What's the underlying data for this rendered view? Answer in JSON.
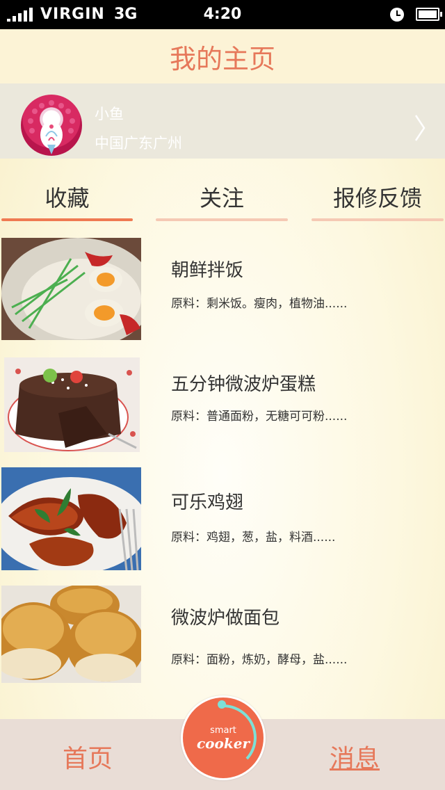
{
  "status_bar": {
    "carrier": "VIRGIN",
    "network": "3G",
    "time": "4:20"
  },
  "header": {
    "title": "我的主页"
  },
  "profile": {
    "name": "小鱼",
    "location": "中国广东广州"
  },
  "tabs": [
    {
      "label": "收藏",
      "active": true
    },
    {
      "label": "关注",
      "active": false
    },
    {
      "label": "报修反馈",
      "active": false
    }
  ],
  "recipes": [
    {
      "name": "朝鲜拌饭",
      "ingredients": "原料：剩米饭。瘦肉，植物油......"
    },
    {
      "name": "五分钟微波炉蛋糕",
      "ingredients": "原料：普通面粉，无糖可可粉......"
    },
    {
      "name": "可乐鸡翅",
      "ingredients": "原料：鸡翅，葱，盐，料酒......"
    },
    {
      "name": "微波炉做面包",
      "ingredients": "原料：面粉，炼奶，酵母，盐......"
    }
  ],
  "bottom_nav": {
    "home_label": "首页",
    "messages_label": "消息",
    "brand_top": "smart",
    "brand_bottom": "cooker"
  },
  "colors": {
    "accent": "#e6785a",
    "center_button": "#ef6a4a",
    "ring": "#7de0d6"
  }
}
